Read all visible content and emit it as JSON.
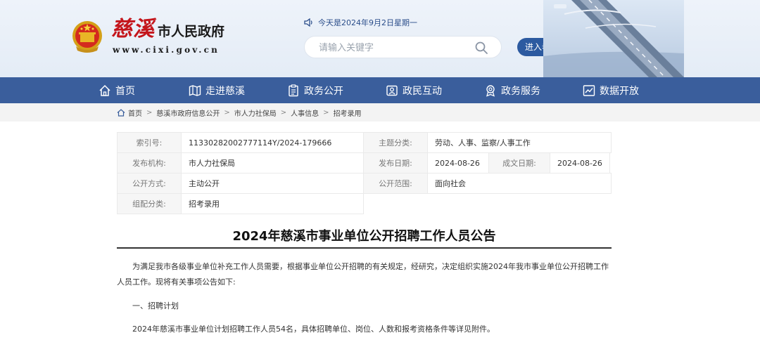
{
  "header": {
    "site_title_calligraphy": "慈溪",
    "site_title_suffix": "市人民政府",
    "site_url": "www.cixi.gov.cn",
    "date_text": "今天是2024年9月2日星期一",
    "search_placeholder": "请输入关键字",
    "elder_mode_label": "进入老年版"
  },
  "nav": {
    "items": [
      {
        "label": "首页",
        "icon": "home-icon"
      },
      {
        "label": "走进慈溪",
        "icon": "map-icon"
      },
      {
        "label": "政务公开",
        "icon": "document-icon"
      },
      {
        "label": "政民互动",
        "icon": "interaction-icon"
      },
      {
        "label": "政务服务",
        "icon": "service-icon"
      },
      {
        "label": "数据开放",
        "icon": "chart-icon"
      }
    ]
  },
  "breadcrumb": [
    "首页",
    "慈溪市政府信息公开",
    "市人力社保局",
    "人事信息",
    "招考录用"
  ],
  "meta": {
    "index_label": "索引号:",
    "index_value": "11330282002777114Y/2024-179666",
    "topic_label": "主题分类:",
    "topic_value": "劳动、人事、监察/人事工作",
    "org_label": "发布机构:",
    "org_value": "市人力社保局",
    "pubdate_label": "发布日期:",
    "pubdate_value": "2024-08-26",
    "docdate_label": "成文日期:",
    "docdate_value": "2024-08-26",
    "method_label": "公开方式:",
    "method_value": "主动公开",
    "scope_label": "公开范围:",
    "scope_value": "面向社会",
    "group_label": "组配分类:",
    "group_value": "招考录用"
  },
  "article": {
    "title": "2024年慈溪市事业单位公开招聘工作人员公告",
    "para1": "为满足我市各级事业单位补充工作人员需要，根据事业单位公开招聘的有关规定，经研究，决定组织实施2024年我市事业单位公开招聘工作人员工作。现将有关事项公告如下:",
    "section1": "一、招聘计划",
    "para2": "2024年慈溪市事业单位计划招聘工作人员54名，具体招聘单位、岗位、人数和报考资格条件等详见附件。"
  },
  "colors": {
    "nav_bg": "#3a5e9c",
    "accent": "#2c5aa0",
    "title_red": "#c4161c"
  }
}
